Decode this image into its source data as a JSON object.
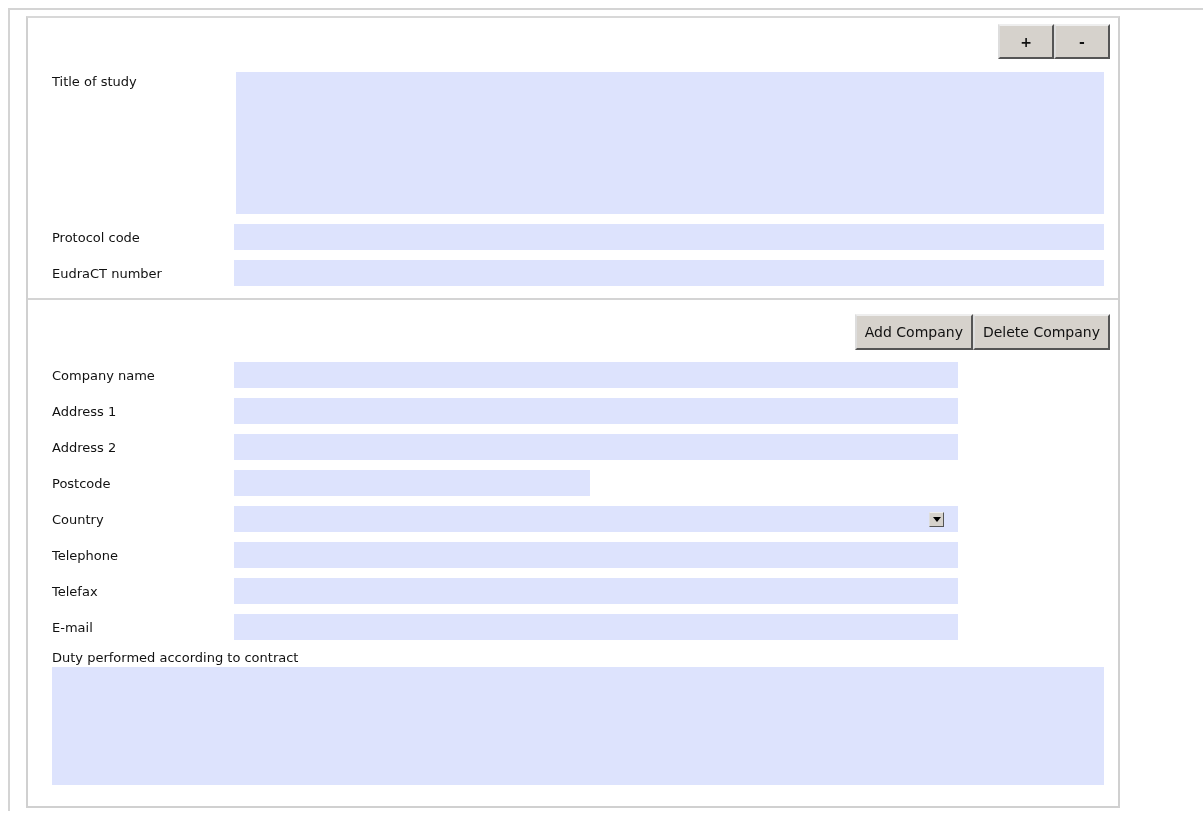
{
  "sections": [
    {
      "buttons": [
        "+",
        "-"
      ],
      "fields": [
        {
          "label": "Title of study",
          "kind": "textarea"
        },
        {
          "label": "Protocol code",
          "kind": "text"
        },
        {
          "label": "EudraCT number",
          "kind": "text"
        }
      ]
    },
    {
      "buttons": [
        "Add Company",
        "Delete Company"
      ],
      "fields": [
        {
          "label": "Company name",
          "kind": "medium"
        },
        {
          "label": "Address 1",
          "kind": "medium"
        },
        {
          "label": "Address 2",
          "kind": "medium"
        },
        {
          "label": "Postcode",
          "kind": "short"
        },
        {
          "label": "Country",
          "kind": "select"
        },
        {
          "label": "Telephone",
          "kind": "medium"
        },
        {
          "label": "Telefax",
          "kind": "medium"
        },
        {
          "label": "E-mail",
          "kind": "medium"
        },
        {
          "label": "Duty performed according to contract",
          "kind": "stacked-textarea"
        }
      ]
    }
  ]
}
